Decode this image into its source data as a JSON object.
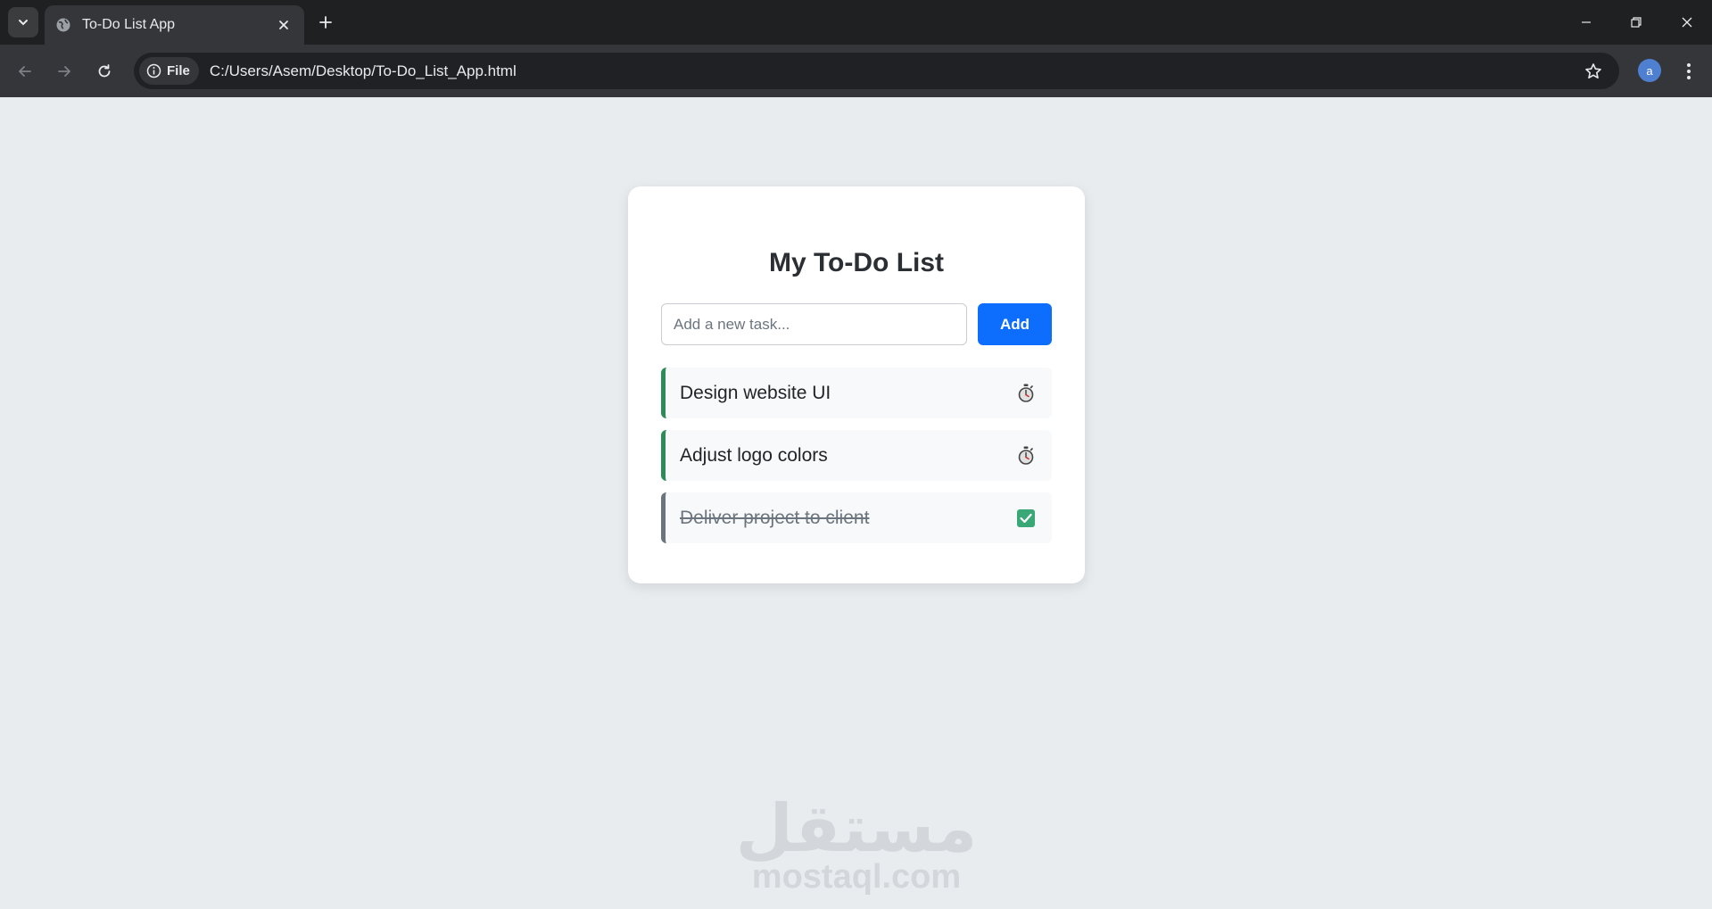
{
  "browser": {
    "tab": {
      "title": "To-Do List App"
    },
    "site_chip_label": "File",
    "url": "C:/Users/Asem/Desktop/To-Do_List_App.html",
    "profile_initial": "a"
  },
  "app": {
    "title": "My To-Do List",
    "input": {
      "placeholder": "Add a new task...",
      "value": ""
    },
    "add_label": "Add",
    "tasks": [
      {
        "text": "Design website UI",
        "done": false,
        "status_icon": "stopwatch-icon"
      },
      {
        "text": "Adjust logo colors",
        "done": false,
        "status_icon": "stopwatch-icon"
      },
      {
        "text": "Deliver project to client",
        "done": true,
        "status_icon": "checkmark-box-icon"
      }
    ]
  },
  "watermark": {
    "arabic": "مستقل",
    "latin": "mostaql.com"
  },
  "colors": {
    "accent_blue": "#0d6efd",
    "pending_border": "#2e8b57",
    "done_border": "#6c757d",
    "check_green": "#3aa876"
  }
}
